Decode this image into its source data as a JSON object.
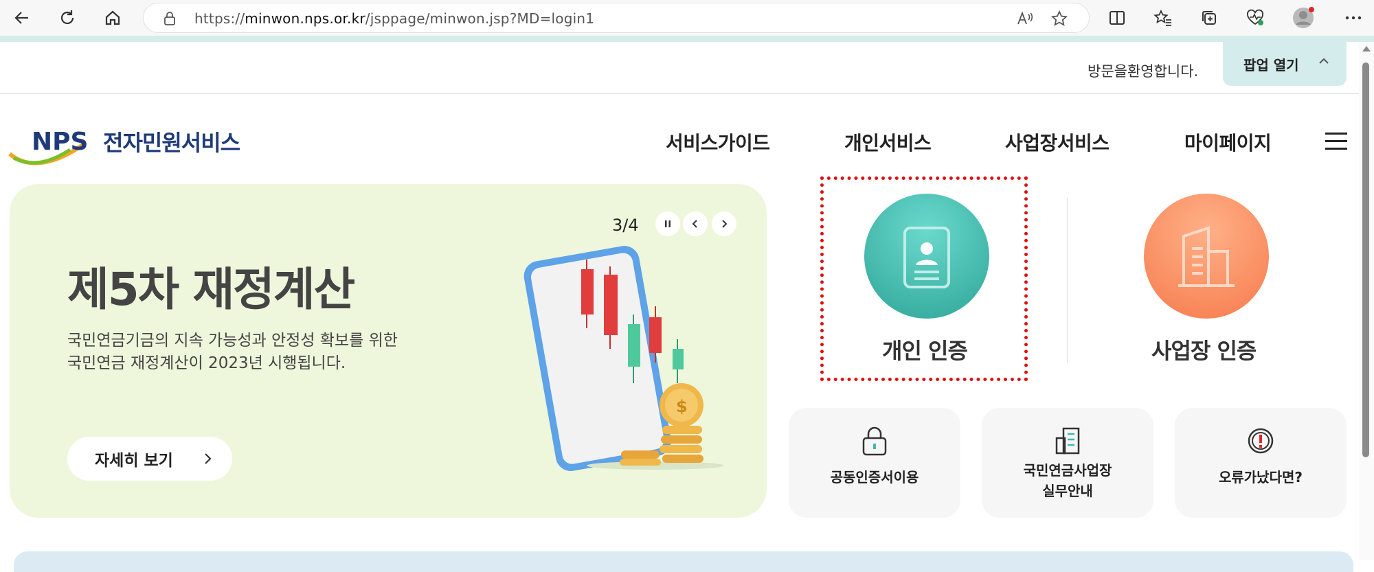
{
  "browser": {
    "url_prefix": "https://",
    "url_host": "minwon.nps.or.kr",
    "url_path": "/jsppage/minwon.jsp?MD=login1"
  },
  "top": {
    "welcome": "방문을환영합니다.",
    "popup_label": "팝업 열기"
  },
  "header": {
    "logo_mark": "NPS",
    "logo_text": "전자민원서비스",
    "nav": [
      "서비스가이드",
      "개인서비스",
      "사업장서비스",
      "마이페이지"
    ]
  },
  "banner": {
    "pager": "3/4",
    "title": "제5차 재정계산",
    "desc_line1": "국민연금기금의 지속 가능성과 안정성 확보를 위한",
    "desc_line2": "국민연금 재정계산이 2023년 시행됩니다.",
    "more_label": "자세히 보기",
    "colors": {
      "bg": "#eef7dc"
    }
  },
  "auth": {
    "personal_label": "개인 인증",
    "business_label": "사업장 인증",
    "colors": {
      "personal": "#3fb9ad",
      "business": "#f78a5d",
      "highlight": "#e01010"
    }
  },
  "quick": {
    "cert_label": "공동인증서이용",
    "guide_line1": "국민연금사업장",
    "guide_line2": "실무안내",
    "error_label": "오류가났다면?"
  }
}
